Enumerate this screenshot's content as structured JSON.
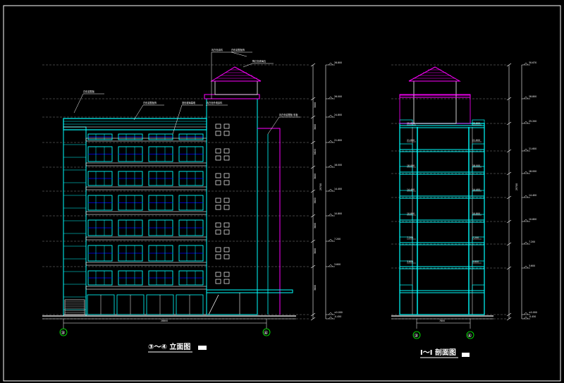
{
  "elevation": {
    "title": "③～④ 立面图",
    "scale_label": "1:100",
    "axis_left": "③",
    "axis_right": "④",
    "overall_dim": "28800",
    "notes": [
      "白色铝塑板",
      "白色铝塑板饰",
      "蓝色玻璃幕墙",
      "乳白色外墙涂料",
      "乳白色铝塑板 彩板",
      "白色铝塑板饰",
      "陶红色琉璃瓦",
      "乳白色涂料"
    ],
    "levels": [
      "28.800",
      "26.000",
      "24.800",
      "21.600",
      "18.000",
      "14.400",
      "10.800",
      "7.200",
      "3.600",
      "±0.000",
      "-0.450"
    ],
    "heights": [
      "3000",
      "3600",
      "3600",
      "3600",
      "3600",
      "3600",
      "3600",
      "3600"
    ],
    "total_height": "29700"
  },
  "section": {
    "title": "Ⅰ～Ⅰ 剖面图",
    "scale_label": "1:100",
    "axis_left": "③",
    "axis_right": "④",
    "width_dim": "7800",
    "levels": [
      "30.670",
      "28.800",
      "25.200",
      "21.600",
      "18.000",
      "14.400",
      "10.800",
      "7.200",
      "3.600",
      "±0.000",
      "-0.450"
    ],
    "floor_labels_left": [
      "25.800",
      "21.600",
      "18.000",
      "14.400",
      "10.800",
      "7.200",
      "3.600"
    ],
    "floor_labels_right": [
      "25.800",
      "21.600",
      "18.000",
      "14.400",
      "10.800",
      "7.200",
      "3.600"
    ],
    "total_height": "29700"
  },
  "colors": {
    "background": "#000000",
    "frame": "#ffffff",
    "cyan": "#00ffff",
    "magenta": "#ff00ff",
    "grey_line": "#7f7f7f",
    "green": "#00ff00",
    "blue": "#0000ff"
  }
}
